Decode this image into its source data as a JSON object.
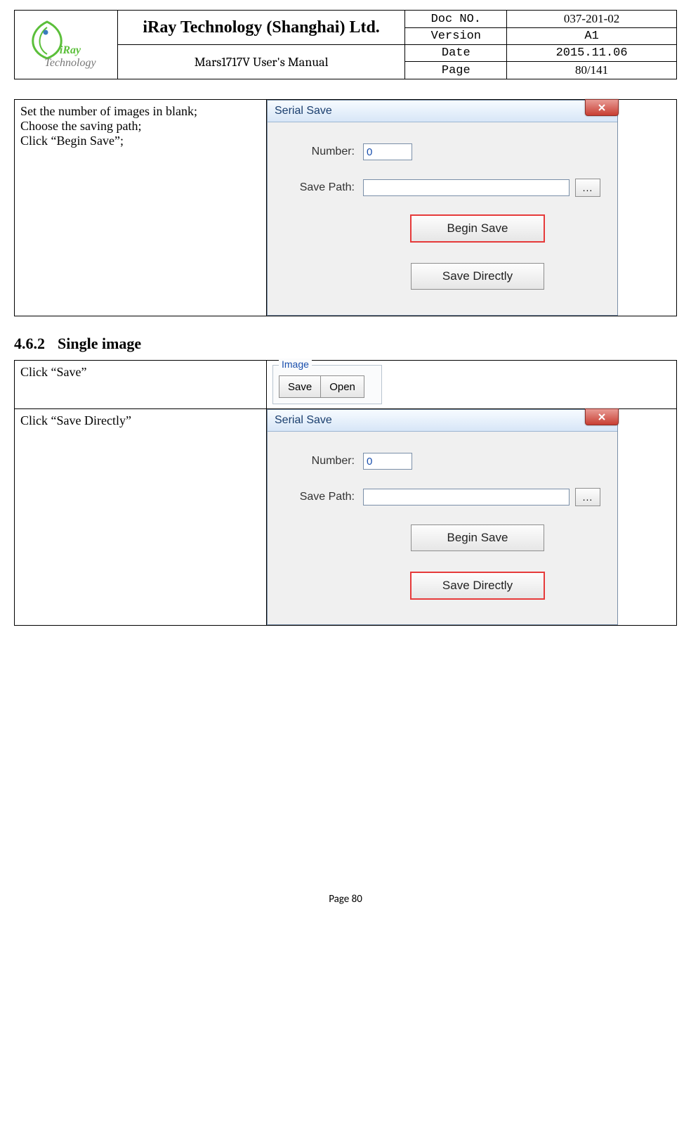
{
  "header": {
    "company": "iRay Technology (Shanghai) Ltd.",
    "manual": "Mars1717V User's Manual",
    "logo_text_prefix": "iRay",
    "logo_text_suffix": "Technology",
    "meta": [
      {
        "label": "Doc NO.",
        "value": "037-201-02"
      },
      {
        "label": "Version",
        "value": "A1"
      },
      {
        "label": "Date",
        "value": "2015.11.06"
      },
      {
        "label": "Page",
        "value": "80/141"
      }
    ]
  },
  "row1": {
    "desc_line1": "Set the number of images in blank;",
    "desc_line2": "Choose the saving path;",
    "desc_line3": "Click “Begin Save”;"
  },
  "dialog": {
    "title": "Serial Save",
    "number_label": "Number:",
    "number_value": "0",
    "savepath_label": "Save Path:",
    "savepath_value": "",
    "browse": "...",
    "begin_save": "Begin Save",
    "save_directly": "Save Directly"
  },
  "section": {
    "num": "4.6.2",
    "title": "Single image"
  },
  "row2": {
    "desc": "Click “Save”"
  },
  "imagebox": {
    "legend": "Image",
    "save": "Save",
    "open": "Open"
  },
  "row3": {
    "desc": "Click “Save Directly”"
  },
  "footer": "Page 80"
}
